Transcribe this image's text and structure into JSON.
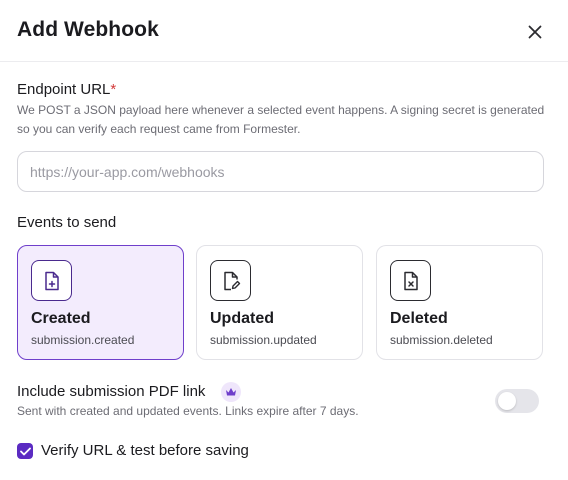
{
  "modal": {
    "title": "Add Webhook",
    "close_icon": "close-icon"
  },
  "endpoint": {
    "label": "Endpoint URL",
    "required_mark": "*",
    "help": "We POST a JSON payload here whenever a selected event happens. A signing secret is generated so you can verify each request came from Formester.",
    "value": "",
    "placeholder": "https://your-app.com/webhooks"
  },
  "events": {
    "label": "Events to send",
    "items": [
      {
        "title": "Created",
        "event": "submission.created",
        "icon": "file-plus-icon",
        "selected": true
      },
      {
        "title": "Updated",
        "event": "submission.updated",
        "icon": "file-edit-icon",
        "selected": false
      },
      {
        "title": "Deleted",
        "event": "submission.deleted",
        "icon": "file-x-icon",
        "selected": false
      }
    ]
  },
  "pdf_link": {
    "label": "Include submission PDF link",
    "badge_icon": "crown-icon",
    "help": "Sent with created and updated events. Links expire after 7 days.",
    "enabled": false
  },
  "verify": {
    "label": "Verify URL & test before saving",
    "checked": true
  },
  "colors": {
    "accent": "#6f3fcb",
    "selected_bg": "#f3ecfd",
    "checkbox": "#5b2bc2",
    "required": "#d33a3a"
  }
}
